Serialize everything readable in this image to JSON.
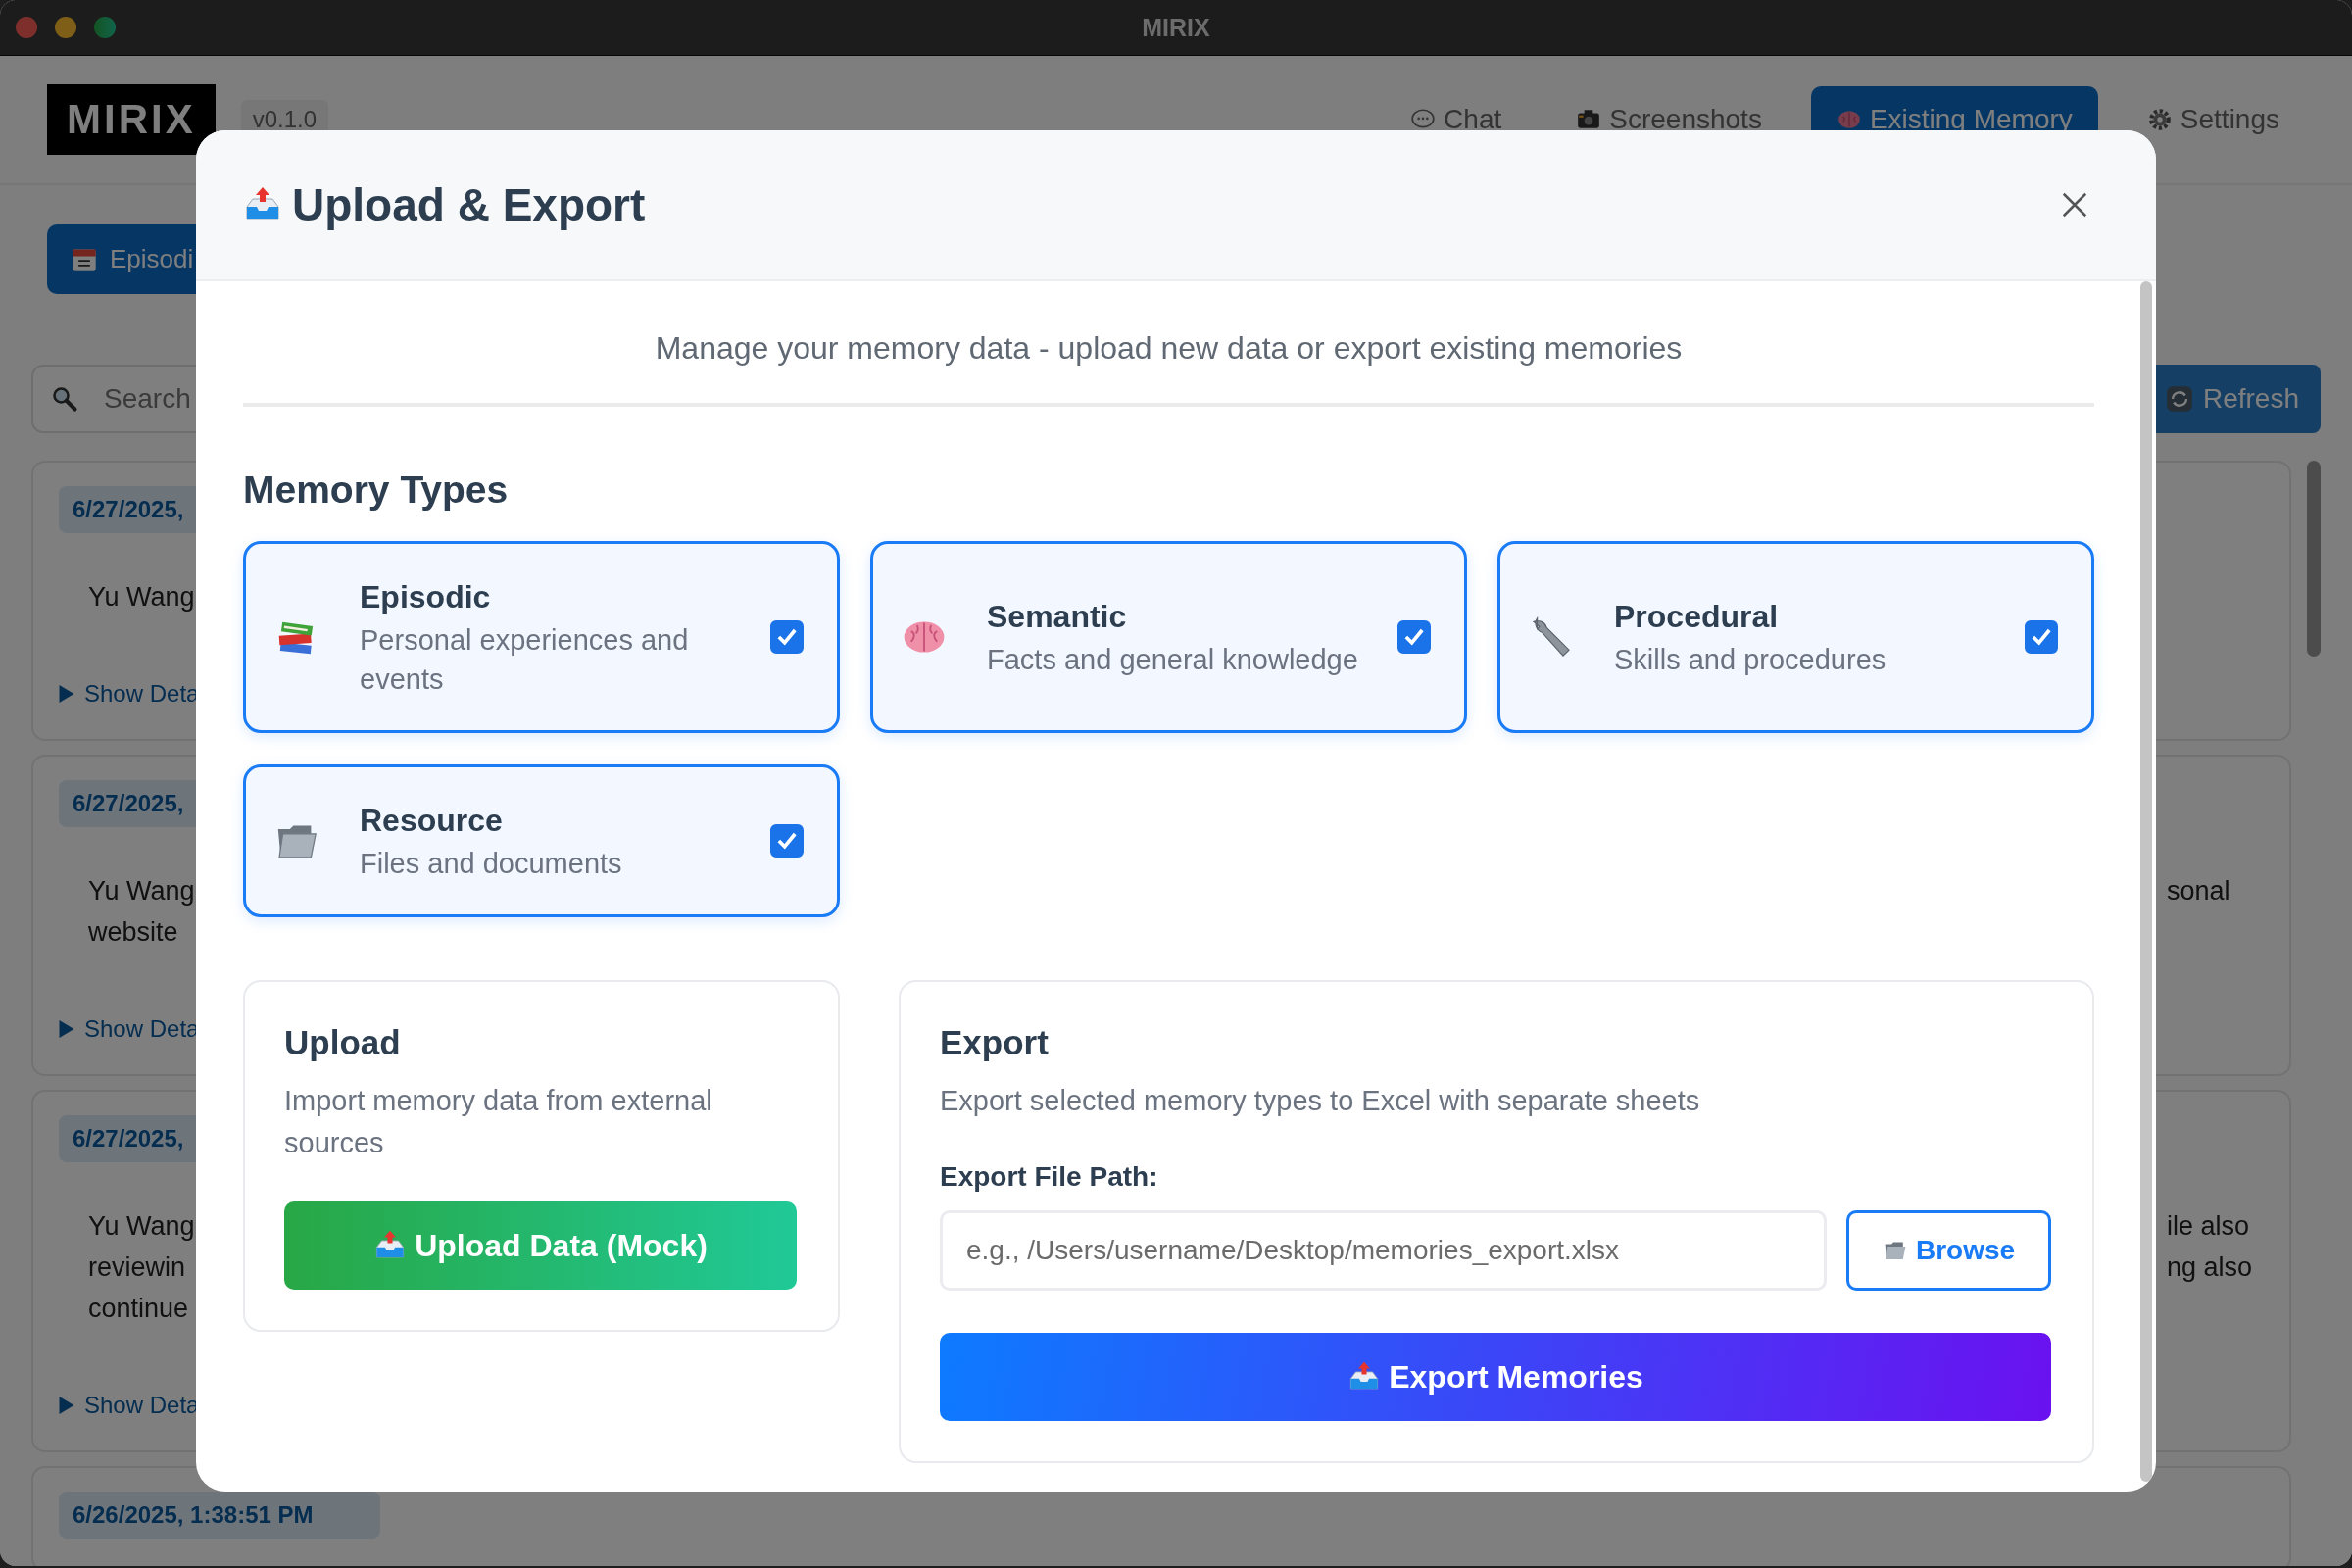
{
  "window": {
    "title": "MIRIX"
  },
  "header": {
    "logo": "MIRIX",
    "version": "v0.1.0",
    "nav": [
      {
        "label": "Chat",
        "selected": false
      },
      {
        "label": "Screenshots",
        "selected": false
      },
      {
        "label": "Existing Memory",
        "selected": true
      },
      {
        "label": "Settings",
        "selected": false
      }
    ]
  },
  "memory_tabs": [
    {
      "label": "Episodi",
      "selected": true
    }
  ],
  "search": {
    "placeholder": "Search"
  },
  "refresh_button": "Refresh",
  "memory_list": [
    {
      "date": "6/27/2025,",
      "left_lines": [
        "Yu Wang"
      ],
      "toggle": "Show Deta"
    },
    {
      "date": "6/27/2025,",
      "left_lines": [
        "Yu Wang",
        "website"
      ],
      "right_lines": [
        "sonal"
      ],
      "toggle": "Show Deta"
    },
    {
      "date": "6/27/2025,",
      "left_lines": [
        "Yu Wang",
        "reviewin",
        "continue"
      ],
      "right_lines": [
        "ile also",
        "ng also"
      ],
      "toggle": "Show Deta"
    },
    {
      "date": "6/26/2025, 1:38:51 PM"
    }
  ],
  "dialog": {
    "title": "Upload & Export",
    "subtitle": "Manage your memory data - upload new data or export existing memories",
    "memory_types_heading": "Memory Types",
    "memory_types": [
      {
        "name": "Episodic",
        "description": "Personal experiences and events",
        "checked": true
      },
      {
        "name": "Semantic",
        "description": "Facts and general knowledge",
        "checked": true
      },
      {
        "name": "Procedural",
        "description": "Skills and procedures",
        "checked": true
      },
      {
        "name": "Resource",
        "description": "Files and documents",
        "checked": true
      }
    ],
    "upload": {
      "title": "Upload",
      "description": "Import memory data from external sources",
      "button": "Upload Data (Mock)"
    },
    "export": {
      "title": "Export",
      "description": "Export selected memory types to Excel with separate sheets",
      "path_label": "Export File Path:",
      "path_placeholder": "e.g., /Users/username/Desktop/memories_export.xlsx",
      "browse_button": "Browse",
      "export_button": "Export Memories"
    }
  }
}
